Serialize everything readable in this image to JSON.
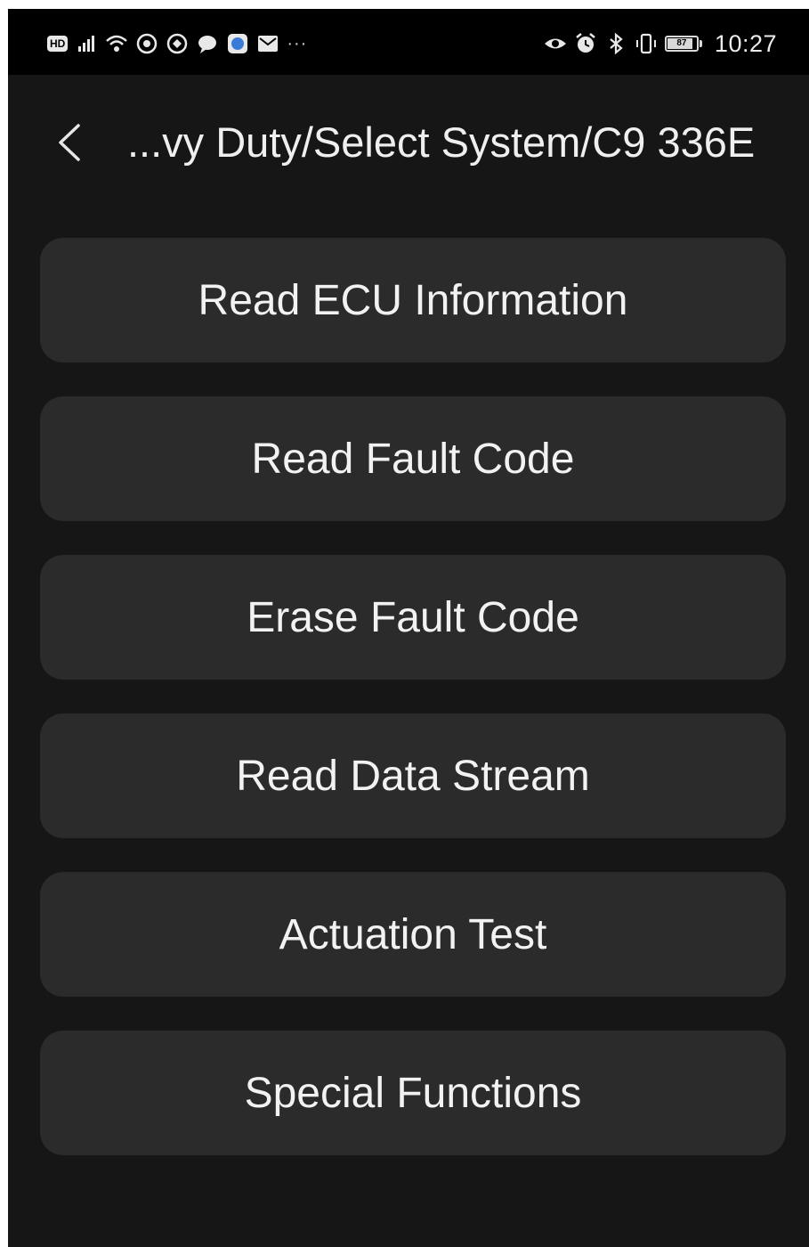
{
  "status_bar": {
    "hd_badge": "HD",
    "more": "···",
    "battery_level": "87",
    "battery_fraction": 0.87,
    "time": "10:27",
    "left_icons": [
      "hd-icon",
      "signal-icon",
      "wifi-icon",
      "app-icon",
      "app-icon",
      "chat-icon",
      "browser-icon",
      "mail-icon",
      "more-icon"
    ],
    "right_icons": [
      "eye-icon",
      "alarm-icon",
      "bluetooth-icon",
      "vibrate-icon",
      "battery-icon"
    ]
  },
  "header": {
    "back_icon": "chevron-left-icon",
    "title": "...vy Duty/Select System/C9 336E"
  },
  "menu": {
    "items": [
      {
        "label": "Read ECU Information"
      },
      {
        "label": "Read Fault Code"
      },
      {
        "label": "Erase Fault Code"
      },
      {
        "label": "Read Data Stream"
      },
      {
        "label": "Actuation Test"
      },
      {
        "label": "Special Functions"
      }
    ]
  },
  "colors": {
    "background": "#161616",
    "status_bar": "#000000",
    "button": "#2b2b2b",
    "text": "#f2f2f2"
  }
}
